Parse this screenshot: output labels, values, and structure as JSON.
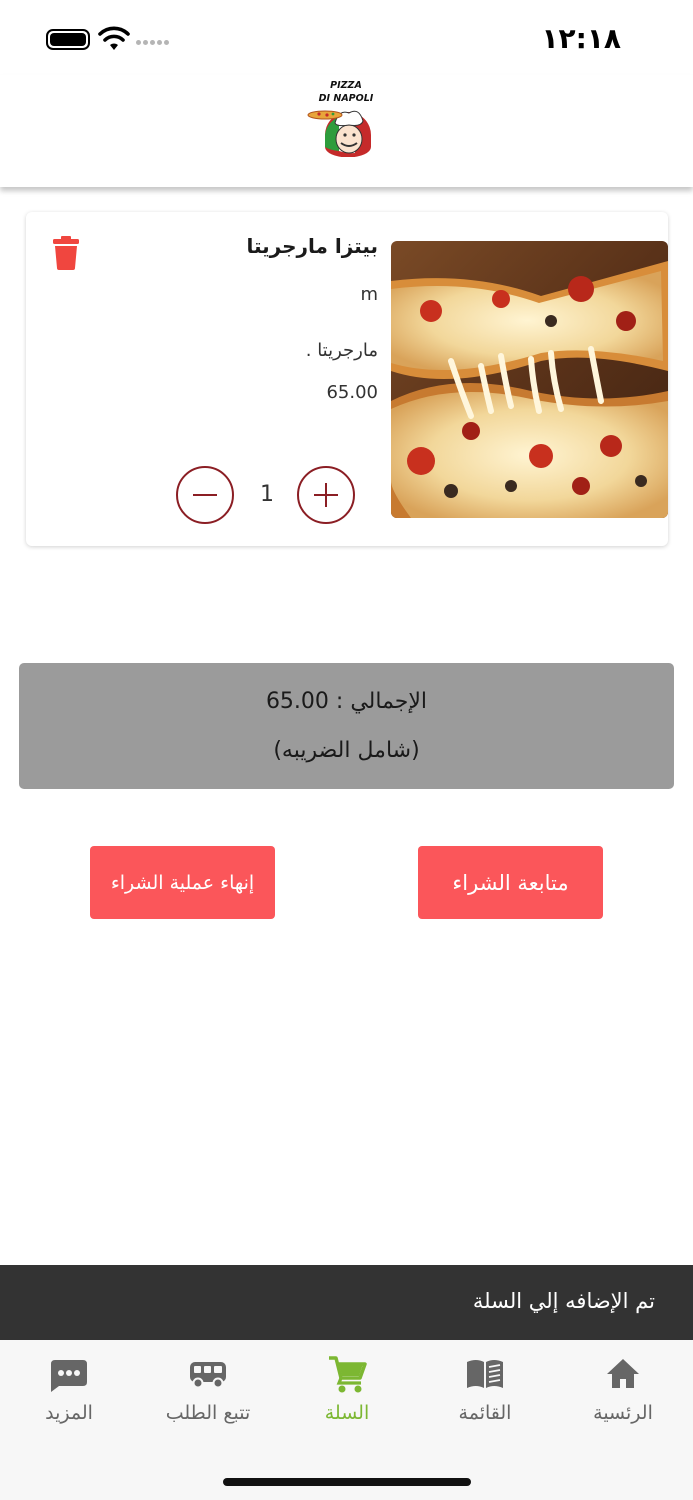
{
  "status_bar": {
    "time": "١٢:١٨"
  },
  "header": {
    "logo_line1": "PIZZA",
    "logo_line2": "DI NAPOLI"
  },
  "cart": {
    "item": {
      "name": "بيتزا مارجريتا",
      "size": "m",
      "description": "مارجريتا .",
      "price": "65.00",
      "quantity": "1",
      "image_icon": "pizza-photo"
    }
  },
  "summary": {
    "total_text": "الإجمالي : 65.00",
    "tax_note": "(شامل الضريبه)"
  },
  "actions": {
    "continue_label": "متابعة الشراء",
    "finish_label": "إنهاء عملية الشراء"
  },
  "toast": {
    "message": "تم الإضافه إلي السلة"
  },
  "tab_bar": {
    "tabs": [
      {
        "label": "الرئسية",
        "icon": "home-icon"
      },
      {
        "label": "القائمة",
        "icon": "book-icon"
      },
      {
        "label": "السلة",
        "icon": "cart-icon",
        "active": true
      },
      {
        "label": "تتبع الطلب",
        "icon": "truck-icon"
      },
      {
        "label": "المزيد",
        "icon": "more-icon"
      }
    ]
  },
  "colors": {
    "accent": "#fb565a",
    "active_tab": "#7cb732",
    "qty_border": "#8b1e24",
    "delete": "#f0463f",
    "toast_bg": "#333333",
    "total_bg": "#9b9b9b"
  }
}
